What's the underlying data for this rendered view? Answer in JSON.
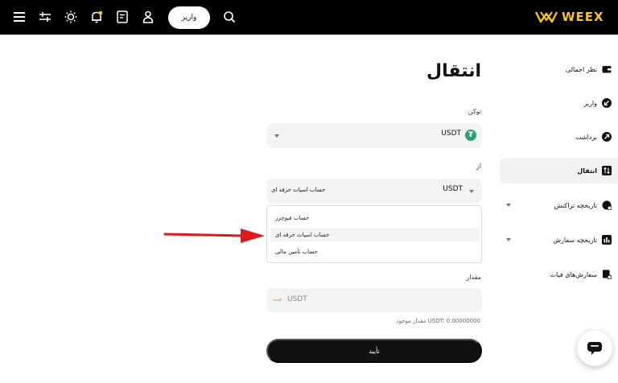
{
  "header": {
    "deposit_label": "واریز",
    "logo_text": "WEEX"
  },
  "page": {
    "title": "انتقال"
  },
  "coin": {
    "label": "توکن",
    "value": "USDT"
  },
  "from": {
    "label": "از",
    "coin": "USDT",
    "account": "حساب اسپات حرفه ای"
  },
  "dropdown": {
    "options": [
      "حساب فیوچرز",
      "حساب اسپات حرفه ای",
      "حساب تأمین مالی"
    ],
    "selected_index": 1
  },
  "amount": {
    "label": "مقدار",
    "placeholder": "USDT",
    "all_label": "همه",
    "available": "مقدار موجود USDT: 0.00000000"
  },
  "confirm_label": "تأیید",
  "sidebar": {
    "items": [
      {
        "label": "نظر اجمالی",
        "icon": "wallet-icon"
      },
      {
        "label": "واریز",
        "icon": "deposit-icon"
      },
      {
        "label": "برداشت",
        "icon": "withdraw-icon"
      },
      {
        "label": "انتقال",
        "icon": "transfer-icon"
      },
      {
        "label": "تاریخچه تراکنش",
        "icon": "history-icon"
      },
      {
        "label": "تاریخچه سفارش",
        "icon": "orders-icon"
      },
      {
        "label": "سفارش‌های فیات",
        "icon": "fiat-icon"
      }
    ]
  },
  "colors": {
    "accent": "#f5c518",
    "tether": "#26a17b",
    "arrow": "#e0191b"
  }
}
